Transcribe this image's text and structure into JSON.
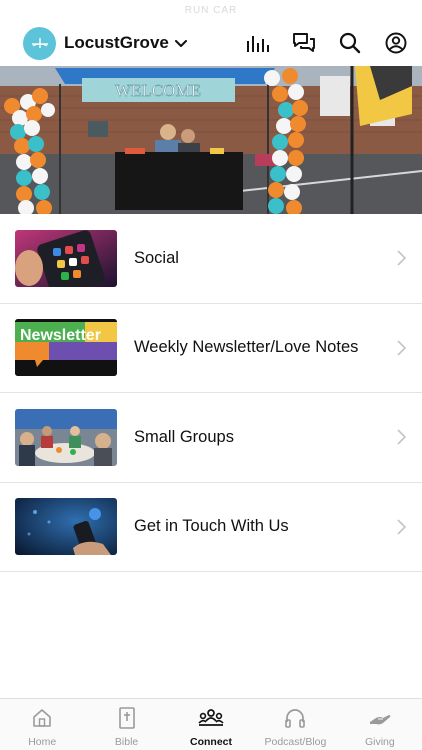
{
  "status": {
    "text": "RUN CAR"
  },
  "header": {
    "app_name": "LocustGrove",
    "icons": [
      "logo-icon",
      "chevron-down-icon",
      "media-bars-icon",
      "chat-icon",
      "search-icon",
      "account-icon"
    ]
  },
  "hero": {
    "banner_text": "WELCOME",
    "colors": {
      "balloon_orange": "#f08a2e",
      "balloon_teal": "#3bbfc9",
      "balloon_white": "#f5f5f5",
      "tent_blue": "#2e78c7"
    }
  },
  "menu": [
    {
      "label": "Social",
      "thumb_icon": "social-media-phone-thumb"
    },
    {
      "label": "Weekly Newsletter/Love Notes",
      "thumb_text": "Newsletter",
      "thumb_icon": "newsletter-thumb"
    },
    {
      "label": "Small Groups",
      "thumb_icon": "small-groups-thumb"
    },
    {
      "label": "Get in Touch With Us",
      "thumb_icon": "contact-phone-thumb"
    }
  ],
  "tabs": [
    {
      "label": "Home",
      "icon": "home-icon",
      "active": false
    },
    {
      "label": "Bible",
      "icon": "bible-icon",
      "active": false
    },
    {
      "label": "Connect",
      "icon": "connect-people-icon",
      "active": true
    },
    {
      "label": "Podcast/Blog",
      "icon": "headphones-icon",
      "active": false
    },
    {
      "label": "Giving",
      "icon": "giving-hand-icon",
      "active": false
    }
  ],
  "colors": {
    "accent": "#5cc3d8",
    "divider": "#e3e3e3",
    "tab_inactive": "#9a9a9a",
    "tab_active": "#111111"
  }
}
